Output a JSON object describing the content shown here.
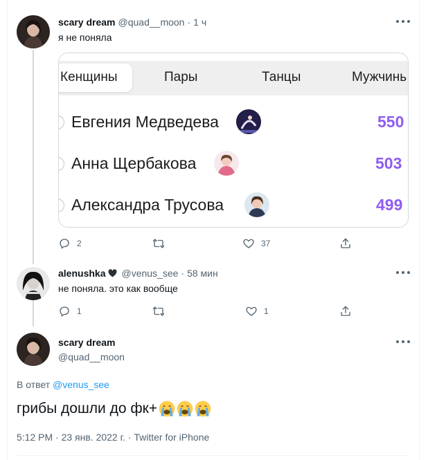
{
  "tweet1": {
    "name": "scary dream",
    "handle": "@quad__moon",
    "dot": "·",
    "time": "1 ч",
    "text": "я не поняла",
    "replies": "2",
    "likes": "37"
  },
  "media": {
    "tabs": [
      "Кенщины",
      "Пары",
      "Танцы",
      "Мужчинь"
    ],
    "rows": [
      {
        "name": "Евгения Медведева",
        "score": "550"
      },
      {
        "name": "Анна Щербакова",
        "score": "503"
      },
      {
        "name": "Александра Трусова",
        "score": "499"
      }
    ]
  },
  "tweet2": {
    "name": "alenushka",
    "handle": "@venus_see",
    "dot": "·",
    "time": "58 мин",
    "text": "не поняла. это как вообще",
    "replies": "1",
    "likes": "1"
  },
  "tweet3": {
    "name": "scary dream",
    "handle": "@quad__moon",
    "reply_prefix": "В ответ",
    "reply_handle": "@venus_see",
    "text": "грибы дошли до фк+",
    "meta": "5:12 PM · 23 янв. 2022 г. · Twitter for iPhone"
  },
  "colors": {
    "link": "#1d9bf0",
    "muted": "#536471",
    "score": "#8e5cf0"
  },
  "icons": [
    "reply-icon",
    "retweet-icon",
    "like-icon",
    "share-icon",
    "more-icon",
    "black-heart-icon",
    "loudly-crying-face-emoji"
  ]
}
